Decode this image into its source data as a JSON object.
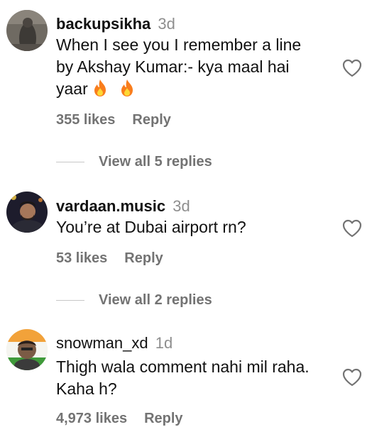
{
  "comments": [
    {
      "username": "backupsikha",
      "time": "3d",
      "text_line1": "When I see you I remember a line",
      "text_line2": "by Akshay Kumar:- kya maal hai",
      "text_line3": "yaar",
      "emojis": [
        "fire-emoji",
        "fire-emoji"
      ],
      "likes": "355 likes",
      "reply_label": "Reply",
      "view_replies": "View all 5 replies"
    },
    {
      "username": "vardaan.music",
      "time": "3d",
      "text_line1": "You’re at Dubai airport rn?",
      "likes": "53 likes",
      "reply_label": "Reply",
      "view_replies": "View all 2 replies"
    },
    {
      "username": "snowman_xd",
      "time": "1d",
      "text_line1": "Thigh wala comment nahi mil raha.",
      "text_line2": "Kaha h?",
      "likes": "4,973 likes",
      "reply_label": "Reply"
    }
  ]
}
